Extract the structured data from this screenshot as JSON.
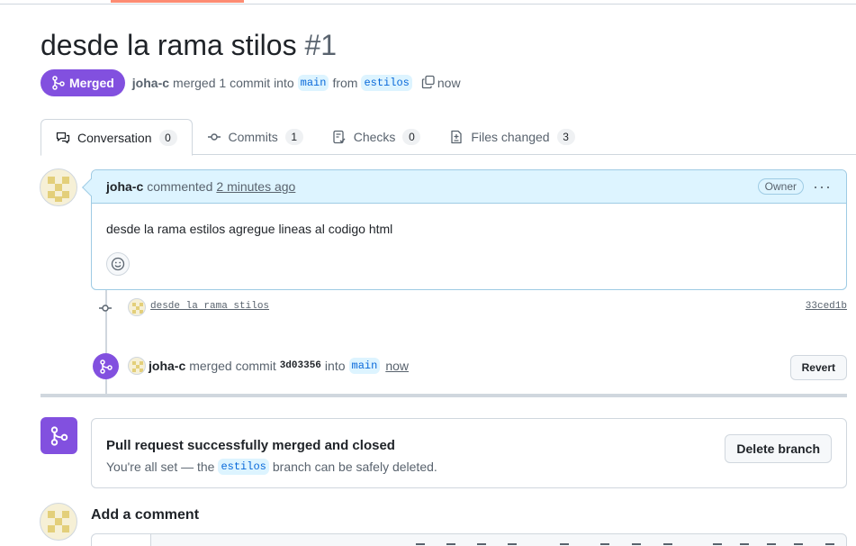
{
  "pr": {
    "title": "desde la rama stilos",
    "number": "#1",
    "status": "Merged",
    "author": "joha-c",
    "merged_text": "merged 1 commit into",
    "base_branch": "main",
    "from_text": "from",
    "head_branch": "estilos",
    "time": "now"
  },
  "tabs": [
    {
      "label": "Conversation",
      "count": "0"
    },
    {
      "label": "Commits",
      "count": "1"
    },
    {
      "label": "Checks",
      "count": "0"
    },
    {
      "label": "Files changed",
      "count": "3"
    }
  ],
  "comment": {
    "author": "joha-c",
    "action": "commented",
    "time": "2 minutes ago",
    "role": "Owner",
    "more": "···",
    "body": "desde la rama estilos agregue lineas al codigo html"
  },
  "commit": {
    "message": "desde la rama stilos",
    "sha": "33ced1b"
  },
  "merge_event": {
    "author": "joha-c",
    "action": "merged commit",
    "sha": "3d03356",
    "into_text": "into",
    "branch": "main",
    "time": "now",
    "revert_label": "Revert"
  },
  "merged_box": {
    "title": "Pull request successfully merged and closed",
    "sub_before": "You're all set — the",
    "branch": "estilos",
    "sub_after": "branch can be safely deleted.",
    "delete_label": "Delete branch"
  },
  "add_comment": {
    "title": "Add a comment"
  },
  "colors": {
    "merged_purple": "#8250df",
    "link_blue": "#0969da",
    "comment_header_bg": "#ddf4ff",
    "tab_accent": "#fd8c73"
  }
}
